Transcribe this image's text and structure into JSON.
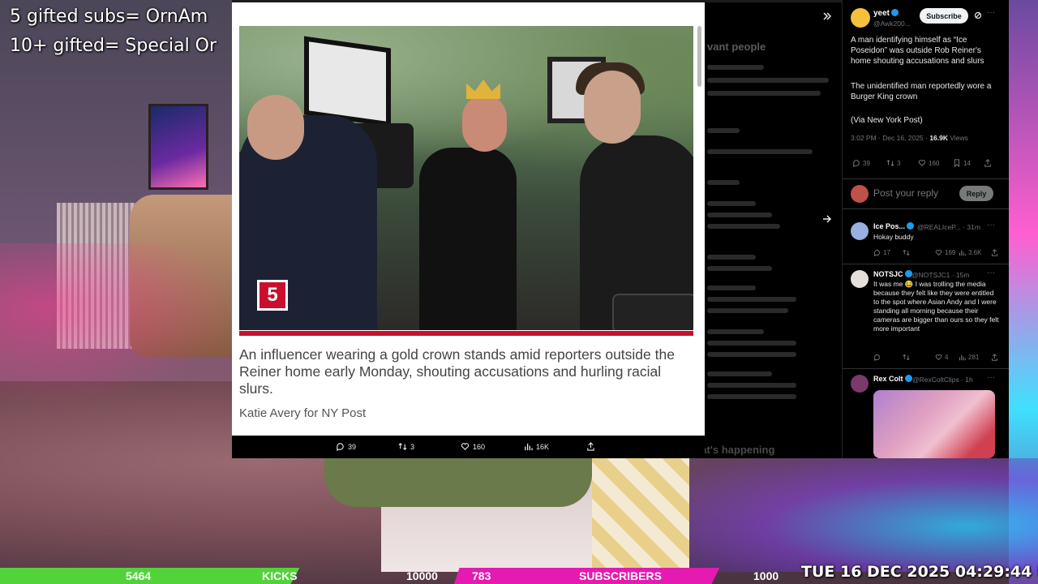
{
  "stream_overlay": {
    "line1": "5 gifted subs= OrnAm",
    "line2": "10+ gifted= Special Or"
  },
  "image_viewer": {
    "badge": "5",
    "caption": "An influencer wearing a gold crown stands amid reporters outside the Reiner home early Monday, shouting accusations and hurling racial slurs.",
    "credit": "Katie Avery for NY Post",
    "actions": {
      "replies": "39",
      "reposts": "3",
      "likes": "160",
      "views": "16K"
    }
  },
  "background_trends": {
    "heading": "vant people",
    "whats_happening": "What's happening"
  },
  "tweet": {
    "author_name": "yeet",
    "author_handle": "@Awk200...",
    "subscribe_label": "Subscribe",
    "paragraphs": [
      "A man identifying himself as “Ice Poseidon” was outside Rob Reiner's home shouting accusations and slurs",
      "The unidentified man reportedly wore a Burger King crown",
      "(Via New York Post)"
    ],
    "timestamp": "3:02 PM · Dec 16, 2025 · ",
    "views_count": "16.9K",
    "views_label": " Views",
    "stats": {
      "replies": "39",
      "reposts": "3",
      "likes": "160",
      "bookmarks": "14"
    },
    "reply_placeholder": "Post your reply",
    "reply_button": "Reply"
  },
  "replies": [
    {
      "name": "Ice Pos...",
      "handle": "@REALIceP... · 31m",
      "text": "Hokay buddy",
      "stats": {
        "replies": "17",
        "reposts": "",
        "likes": "169",
        "views": "3.6K"
      }
    },
    {
      "name": "NOTSJC",
      "handle": "@NOTSJC1 · 15m",
      "text": "It was me 😂 I was trolling the media because they felt like they were entitled to the spot where Asian Andy and I were standing all morning because their cameras are bigger than ours so they felt more important",
      "stats": {
        "replies": "",
        "reposts": "",
        "likes": "4",
        "views": "281"
      }
    },
    {
      "name": "Rex Colt",
      "handle": "@RexColtClips · 1h",
      "text": ""
    }
  ],
  "ticker": {
    "kicks_count": "5464",
    "kicks_label": "KICKS",
    "kicks_goal": "10000",
    "subs_count": "783",
    "subs_label": "SUBSCRIBERS",
    "subs_goal": "1000",
    "kicks_progress": 0.5464,
    "subs_progress": 0.783,
    "datetime": "TUE 16 DEC 2025 04:29:44 PM"
  },
  "colors": {
    "accent": "#1d9bf0",
    "nypost_red": "#c8102e",
    "kicks_green": "#53d33a",
    "subs_magenta": "#e51ab0"
  }
}
